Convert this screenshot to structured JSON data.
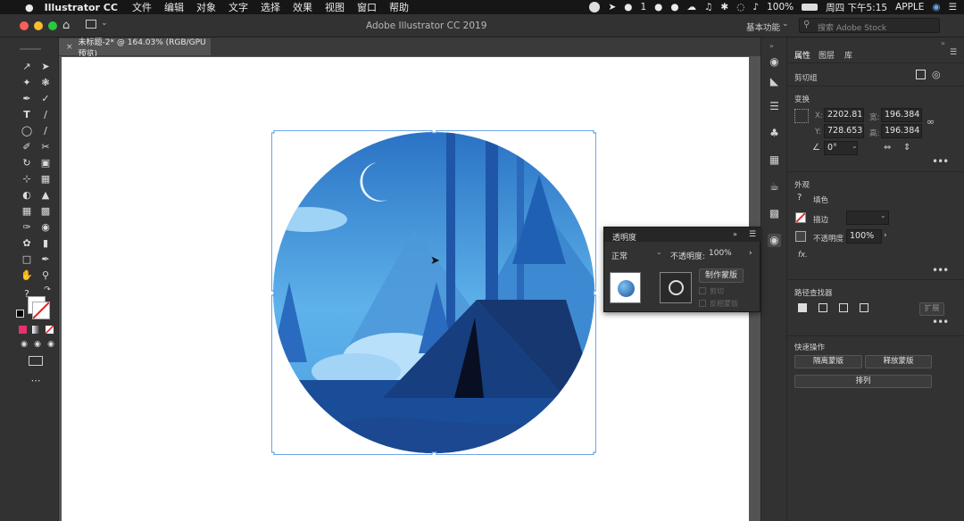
{
  "menubar": {
    "app_name": "Illustrator CC",
    "menus": [
      "文件",
      "编辑",
      "对象",
      "文字",
      "选择",
      "效果",
      "视图",
      "窗口",
      "帮助"
    ],
    "status_count": "1",
    "battery": "100%",
    "clock": "周四 下午5:15",
    "user": "APPLE"
  },
  "titlebar": {
    "title": "Adobe Illustrator CC 2019",
    "workspace": "基本功能",
    "search_placeholder": "搜索 Adobe Stock"
  },
  "document_tab": {
    "close": "×",
    "name": "未标题-2* @ 164.03% (RGB/GPU 预览)"
  },
  "properties": {
    "tabs": [
      "属性",
      "图层",
      "库"
    ],
    "selection_type": "剪切组",
    "transform": {
      "title": "变换",
      "x_label": "X:",
      "x": "2202.81",
      "y_label": "Y:",
      "y": "728.653",
      "w_label": "宽:",
      "w": "196.384",
      "h_label": "高:",
      "h": "196.384",
      "angle": "0°"
    },
    "appearance": {
      "title": "外观",
      "fill": "填色",
      "stroke": "描边",
      "opacity_label": "不透明度",
      "opacity": "100%",
      "fx": "fx."
    },
    "pathfinder": {
      "title": "路径查找器",
      "expand": "扩展"
    },
    "quick_actions": {
      "title": "快速操作",
      "isolate_mask": "隔离蒙版",
      "release_mask": "释放蒙版",
      "arrange": "排列"
    }
  },
  "transparency_panel": {
    "title": "透明度",
    "blend_mode": "正常",
    "opacity_label": "不透明度:",
    "opacity": "100%",
    "make_mask": "制作蒙版",
    "clip": "剪切",
    "invert_mask": "反相蒙版"
  },
  "colors": {
    "panel_bg": "#323232",
    "canvas_bg": "#535353",
    "selection": "#4a90e2",
    "sky_light": "#5aa9e6",
    "sky_dark": "#1d4f96"
  }
}
